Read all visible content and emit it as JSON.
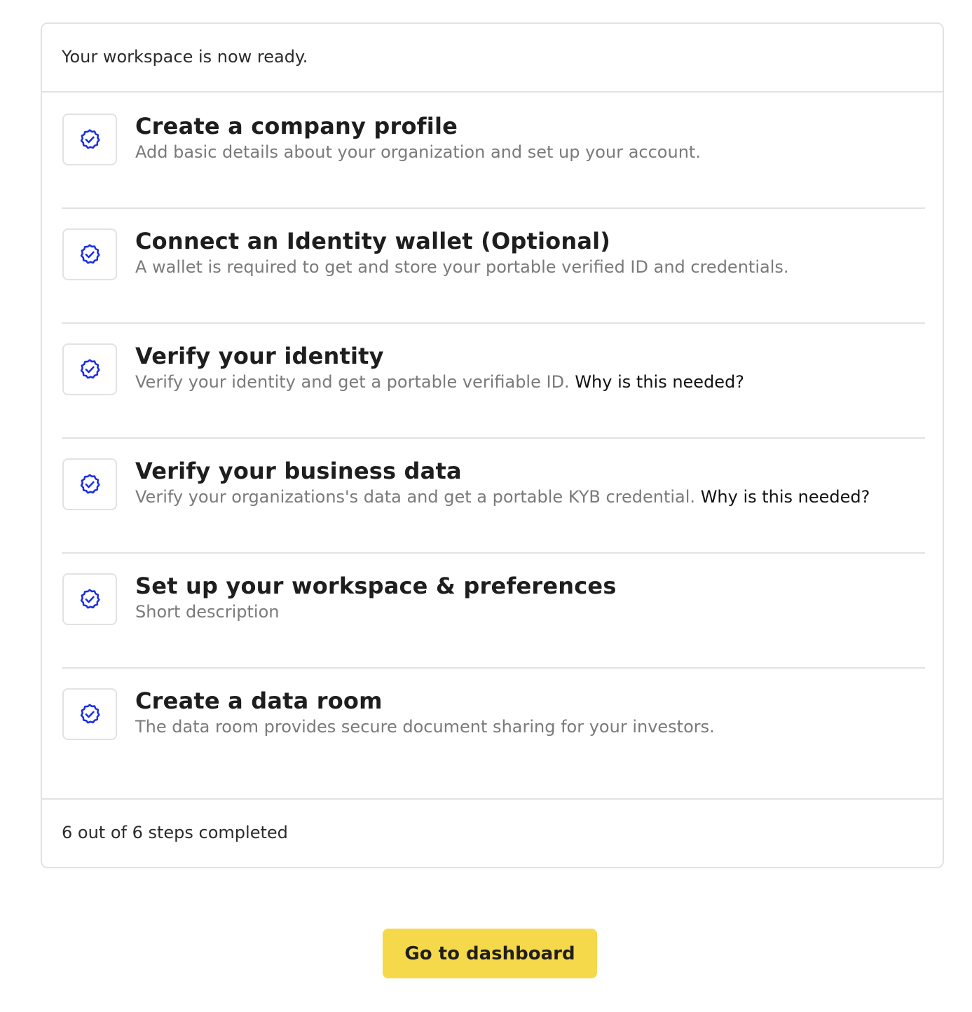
{
  "header": {
    "title": "Your workspace is now ready."
  },
  "steps": [
    {
      "title": "Create a company profile",
      "description": "Add basic details about your organization and set up your account.",
      "link": "",
      "icon": "check-badge-icon",
      "completed": true
    },
    {
      "title": "Connect an Identity wallet (Optional)",
      "description": "A wallet is required to get and store your portable verified ID and credentials.",
      "link": "",
      "icon": "check-badge-icon",
      "completed": true
    },
    {
      "title": "Verify your identity",
      "description": "Verify your identity and get a portable verifiable ID.",
      "link": "Why is this needed?",
      "icon": "check-badge-icon",
      "completed": true
    },
    {
      "title": "Verify your business data",
      "description": "Verify your organizations's data and get a portable KYB credential.",
      "link": "Why is this needed?",
      "icon": "check-badge-icon",
      "completed": true
    },
    {
      "title": "Set up your workspace & preferences",
      "description": "Short description",
      "link": "",
      "icon": "check-badge-icon",
      "completed": true
    },
    {
      "title": "Create a data room",
      "description": "The data room provides secure document sharing for your investors.",
      "link": "",
      "icon": "check-badge-icon",
      "completed": true
    }
  ],
  "footer": {
    "progress_text": "6 out of 6 steps completed"
  },
  "cta": {
    "label": "Go to dashboard"
  },
  "colors": {
    "icon": "#1a2ee8",
    "button": "#f6d84b",
    "border": "#e2e2e2",
    "muted_text": "#7a7a7a"
  }
}
